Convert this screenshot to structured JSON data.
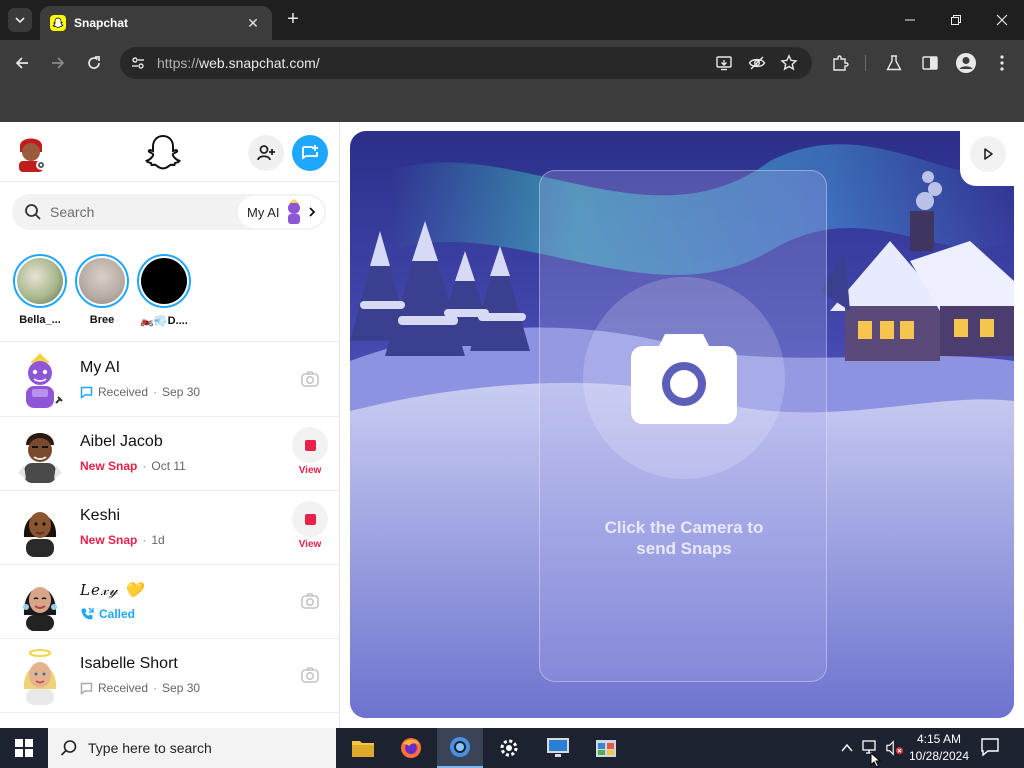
{
  "browser": {
    "tab_title": "Snapchat",
    "url_protocol": "https://",
    "url_host": "web.snapchat.com/",
    "close_tab": "✕",
    "new_tab": "+"
  },
  "sidebar": {
    "search_placeholder": "Search",
    "my_ai_label": "My AI",
    "stories": [
      {
        "name": "Bella_..."
      },
      {
        "name": "Bree"
      },
      {
        "name": "🏍️💨D...."
      }
    ],
    "chats": [
      {
        "name": "My AI",
        "status": "Received",
        "time": "Sep 30",
        "state": "received"
      },
      {
        "name": "Aibel Jacob",
        "status": "New Snap",
        "time": "Oct 11",
        "state": "newsnap",
        "action": "View"
      },
      {
        "name": "Keshi",
        "status": "New Snap",
        "time": "1d",
        "state": "newsnap",
        "action": "View"
      },
      {
        "name": "𝐿𝑒𝓍𝓎 💛",
        "status": "Called",
        "time": "",
        "state": "called"
      },
      {
        "name": "Isabelle Short",
        "status": "Received",
        "time": "Sep 30",
        "state": "received"
      }
    ]
  },
  "camera": {
    "line1": "Click the Camera to",
    "line2": "send Snaps"
  },
  "taskbar": {
    "search_placeholder": "Type here to search",
    "time": "4:15 AM",
    "date": "10/28/2024"
  },
  "colors": {
    "snap_blue": "#1ea7fd",
    "snap_red": "#e8204a",
    "snap_yellow": "#fffc00"
  }
}
